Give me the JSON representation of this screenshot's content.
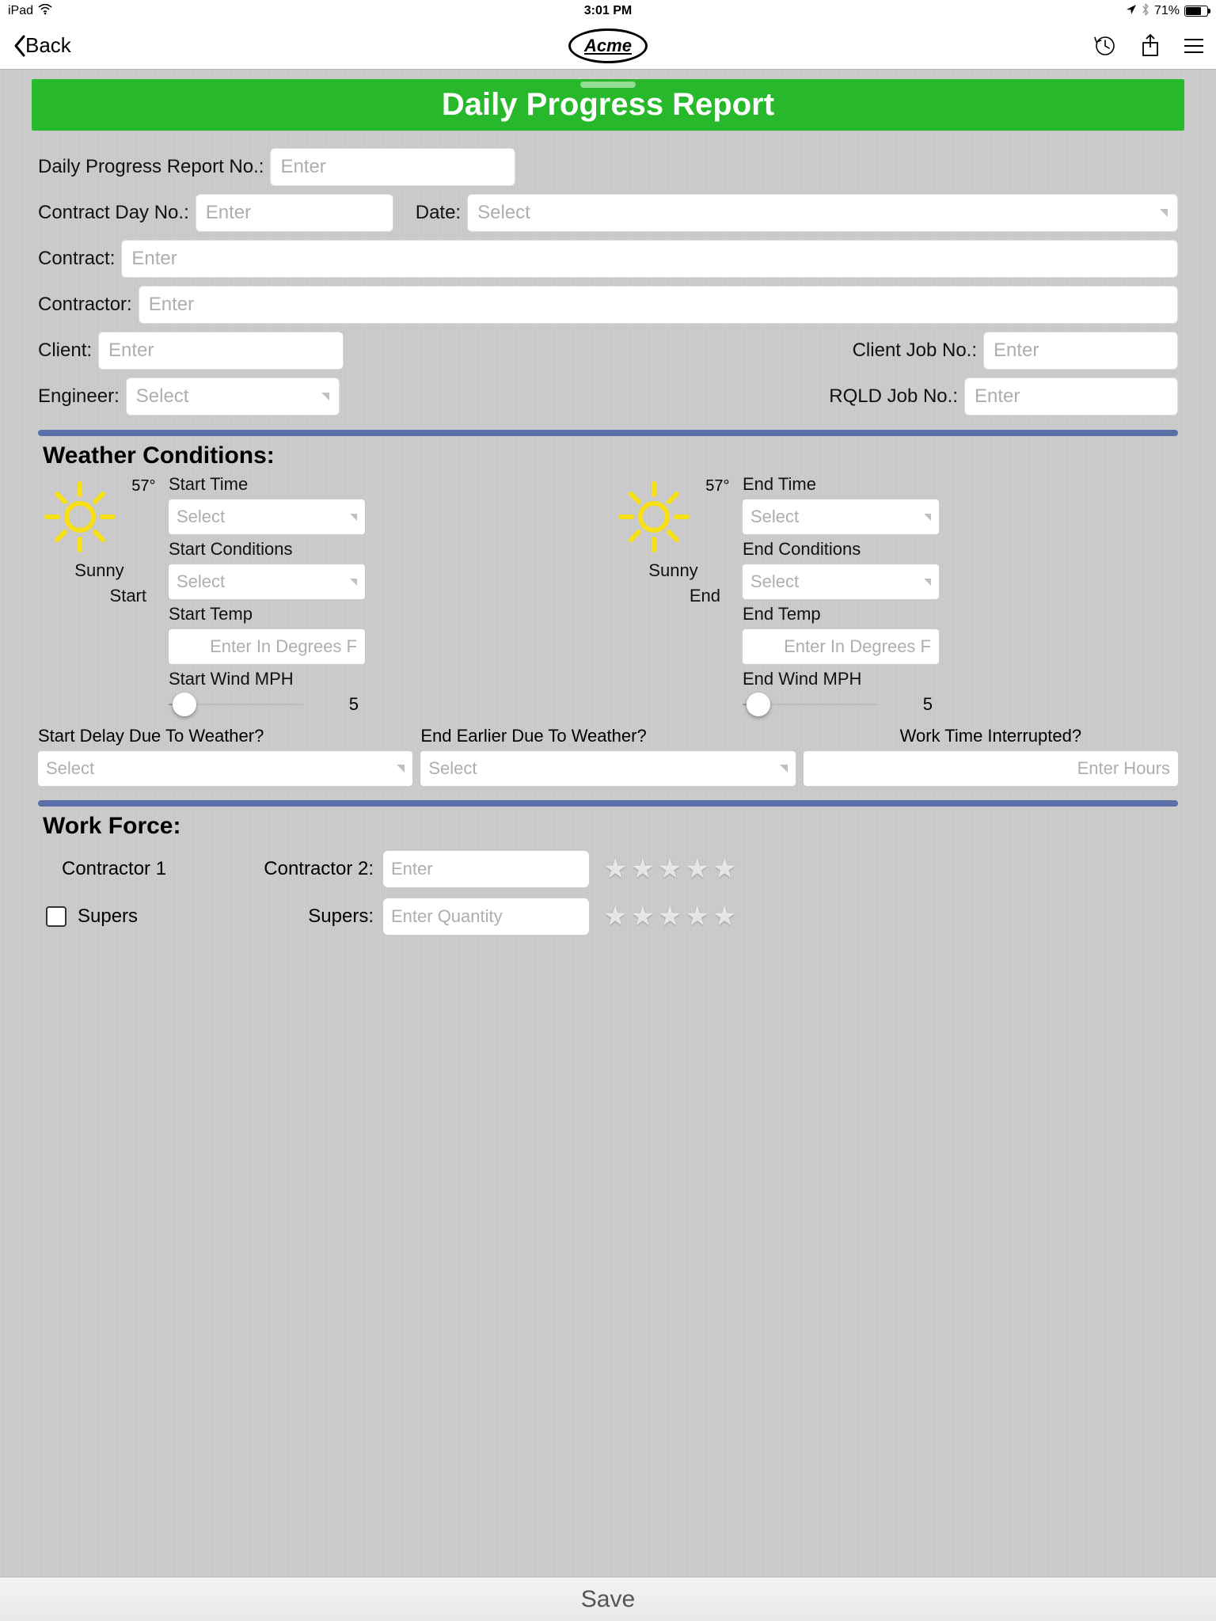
{
  "status": {
    "device": "iPad",
    "time": "3:01 PM",
    "battery_pct": "71%"
  },
  "nav": {
    "back": "Back",
    "logo": "Acme"
  },
  "title": "Daily Progress Report",
  "labels": {
    "dpr_no": "Daily Progress Report No.:",
    "contract_day_no": "Contract Day No.:",
    "date": "Date:",
    "contract": "Contract:",
    "contractor": "Contractor:",
    "client": "Client:",
    "client_job_no": "Client Job No.:",
    "engineer": "Engineer:",
    "rqld_job_no": "RQLD Job No.:"
  },
  "placeholders": {
    "enter": "Enter",
    "select": "Select"
  },
  "weather": {
    "heading": "Weather Conditions:",
    "start": {
      "temp": "57°",
      "condition": "Sunny",
      "phase": "Start",
      "labels": {
        "time": "Start Time",
        "conditions": "Start Conditions",
        "temp": "Start Temp",
        "wind": "Start Wind MPH"
      },
      "temp_placeholder": "Enter In Degrees F",
      "wind_value": "5"
    },
    "end": {
      "temp": "57°",
      "condition": "Sunny",
      "phase": "End",
      "labels": {
        "time": "End Time",
        "conditions": "End Conditions",
        "temp": "End Temp",
        "wind": "End Wind MPH"
      },
      "temp_placeholder": "Enter In Degrees F",
      "wind_value": "5"
    },
    "q": {
      "start_delay": "Start Delay Due To Weather?",
      "end_earlier": "End Earlier Due To Weather?",
      "interrupted": "Work Time Interrupted?",
      "hours_placeholder": "Enter Hours"
    }
  },
  "workforce": {
    "heading": "Work Force:",
    "contractor1": "Contractor 1",
    "contractor2": "Contractor 2:",
    "supers": "Supers",
    "supers2": "Supers:",
    "qty_placeholder": "Enter Quantity"
  },
  "save": "Save"
}
